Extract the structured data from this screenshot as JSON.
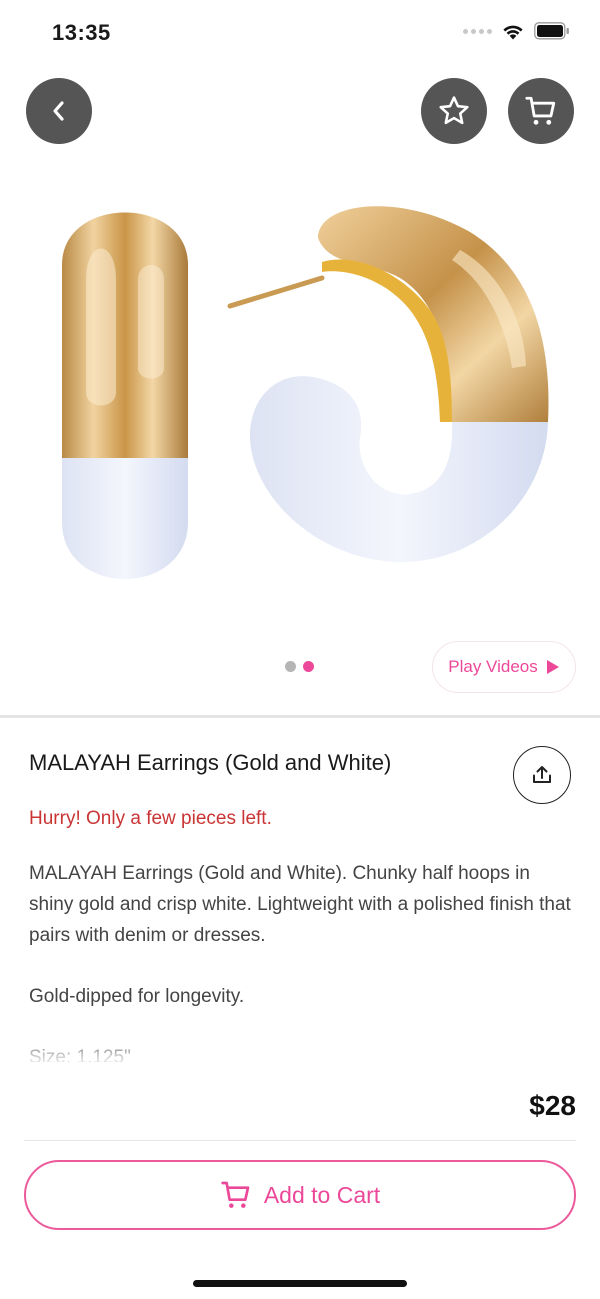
{
  "status_bar": {
    "time": "13:35"
  },
  "nav": {
    "back_icon": "chevron-left-icon",
    "favorite_icon": "star-icon",
    "cart_icon": "cart-icon"
  },
  "gallery": {
    "dots": 2,
    "active_index": 1,
    "play_label": "Play Videos"
  },
  "product": {
    "title": "MALAYAH Earrings (Gold and White)",
    "stock_note": "Hurry! Only a few pieces left.",
    "description_1": "MALAYAH Earrings (Gold and White). Chunky half hoops in shiny gold and crisp white. Lightweight with a polished finish that pairs with denim or dresses.",
    "description_2": "Gold-dipped for longevity.",
    "description_3": "Size: 1.125\"",
    "price": "$28"
  },
  "actions": {
    "add_to_cart_label": "Add to Cart"
  },
  "colors": {
    "accent": "#ec4899",
    "stock_warning": "#c93434",
    "nav_button": "#555555"
  }
}
